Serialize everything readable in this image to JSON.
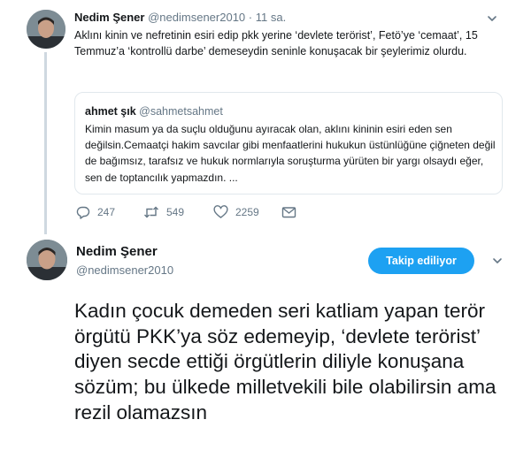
{
  "tweet1": {
    "author_name": "Nedim Şener",
    "handle": "@nedimsener2010",
    "separator": "·",
    "time": "11 sa.",
    "text": "Aklını kinin ve nefretinin esiri edip pkk yerine ‘devlete terörist’, Fetö’ye ‘cemaat’, 15 Temmuz’a ‘kontrollü darbe’ demeseydin seninle konuşacak bir şeylerimiz olurdu.",
    "quoted": {
      "author_name": "ahmet şık",
      "handle": "@sahmetsahmet",
      "text": "Kimin masum ya da suçlu olduğunu ayıracak olan, aklını kininin esiri eden sen değilsin.Cemaatçi hakim savcılar gibi menfaatlerini hukukun üstünlüğüne çiğneten değil de bağımsız, tarafsız ve hukuk normlarıyla soruşturma yürüten bir yargı olsaydı eğer, sen de toptancılık yapmazdın. ..."
    },
    "actions": {
      "reply_count": "247",
      "retweet_count": "549",
      "like_count": "2259"
    }
  },
  "tweet2": {
    "author_name": "Nedim Şener",
    "handle": "@nedimsener2010",
    "follow_label": "Takip ediliyor",
    "text": "Kadın çocuk demeden seri katliam yapan terör örgütü PKK’ya söz edemeyip, ‘devlete terörist’ diyen secde ettiği örgütlerin diliyle konuşana sözüm; bu ülkede milletvekili bile olabilirsin ama rezil olamazsın"
  },
  "colors": {
    "accent": "#1da1f2",
    "text": "#14171a",
    "muted": "#657786",
    "border": "#e1e8ed",
    "thread_line": "#cfd8e0"
  },
  "icons": [
    "reply-icon",
    "retweet-icon",
    "like-icon",
    "message-icon",
    "chevron-down-icon"
  ]
}
